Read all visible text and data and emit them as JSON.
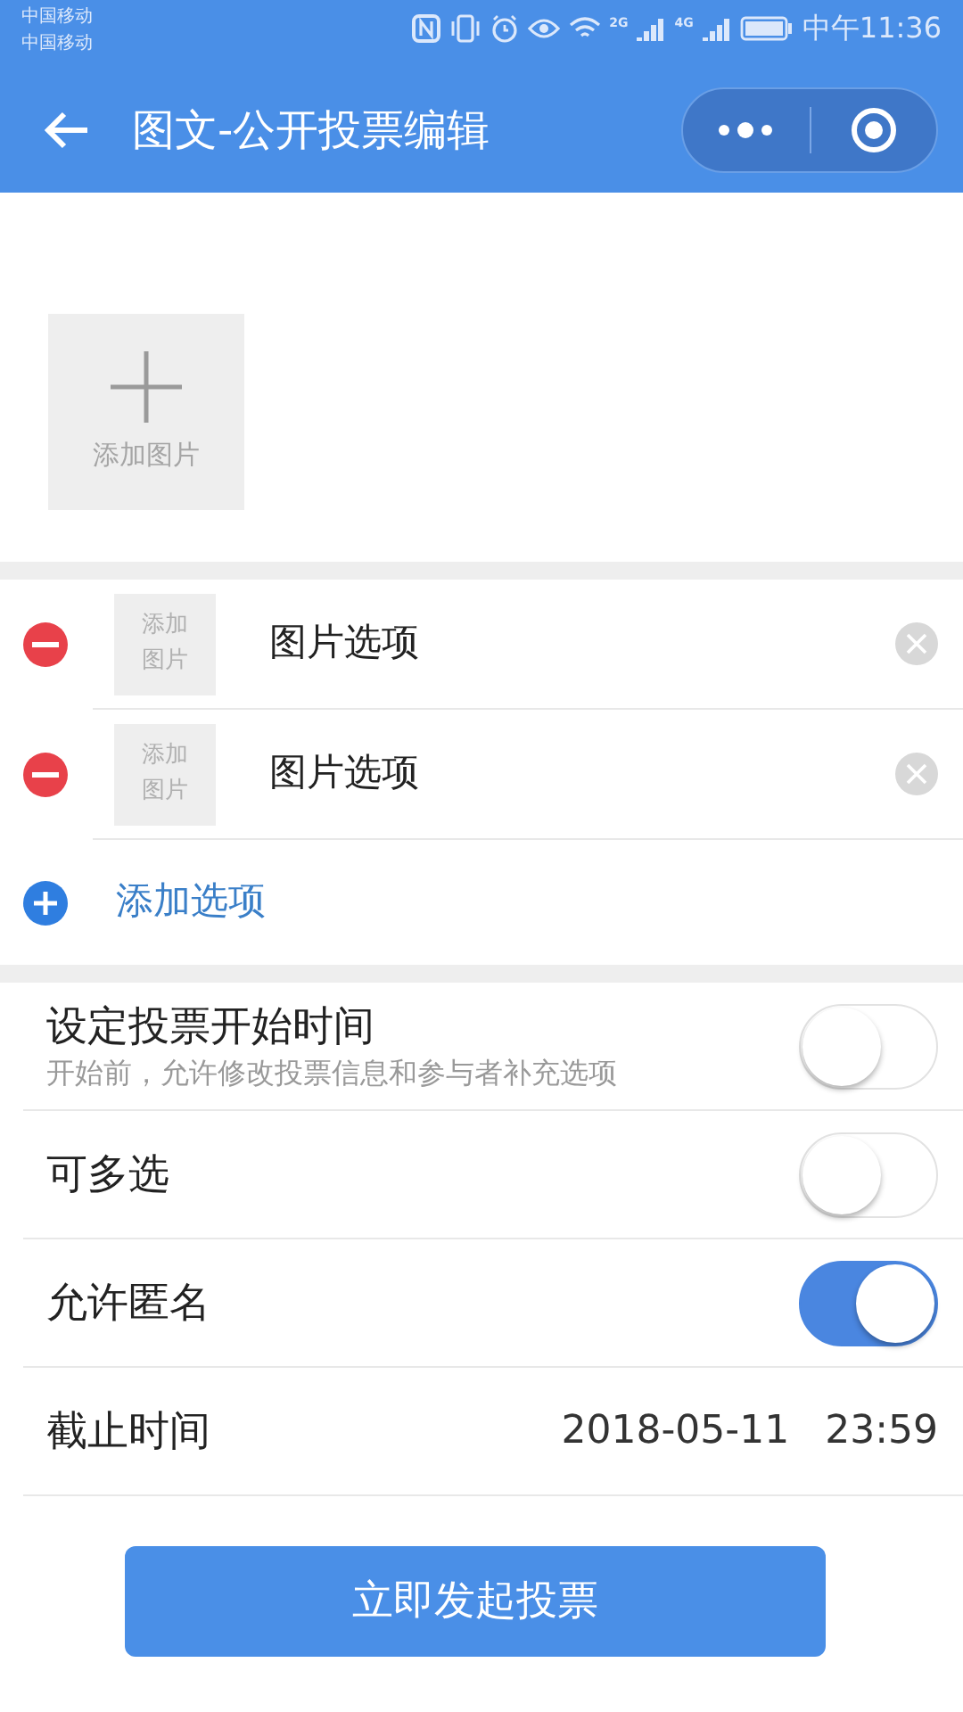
{
  "status_bar": {
    "carriers": [
      "中国移动",
      "中国移动"
    ],
    "network_labels": [
      "2G",
      "4G"
    ],
    "time": "中午11:36"
  },
  "header": {
    "title": "图文-公开投票编辑"
  },
  "cover": {
    "label": "添加图片"
  },
  "options": [
    {
      "thumb_label": "添加图片",
      "text": "图片选项"
    },
    {
      "thumb_label": "添加图片",
      "text": "图片选项"
    }
  ],
  "add_option": "添加选项",
  "settings": [
    {
      "kind": "toggle",
      "label": "设定投票开始时间",
      "hint": "开始前，允许修改投票信息和参与者补充选项",
      "on": false
    },
    {
      "kind": "toggle",
      "label": "可多选",
      "on": false
    },
    {
      "kind": "toggle",
      "label": "允许匿名",
      "on": true
    },
    {
      "kind": "datetime",
      "label": "截止时间",
      "date": "2018-05-11",
      "time": "23:59"
    }
  ],
  "submit": "立即发起投票"
}
